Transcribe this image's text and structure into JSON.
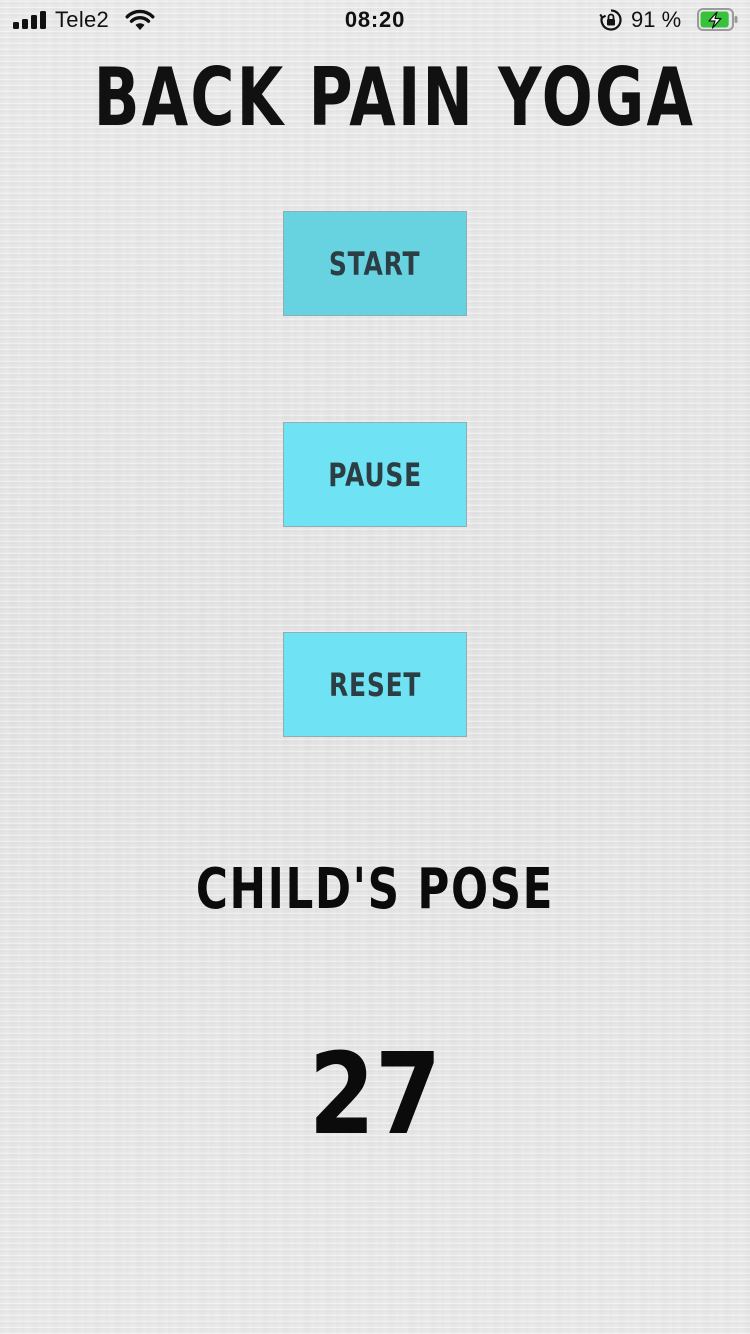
{
  "status_bar": {
    "carrier": "Tele2",
    "time": "08:20",
    "battery_percent": "91 %",
    "battery_level": 0.91,
    "icons": [
      "signal-icon",
      "wifi-icon",
      "orientation-lock-icon",
      "battery-charging-icon"
    ]
  },
  "app": {
    "title": "BACK PAIN YOGA"
  },
  "controls": {
    "start_label": "START",
    "pause_label": "PAUSE",
    "reset_label": "RESET"
  },
  "session": {
    "pose_name": "CHILD'S POSE",
    "seconds_remaining": "27"
  },
  "colors": {
    "button_bg": "#6fe3f3",
    "button_text": "#2c3e44",
    "background": "#e9e9e9",
    "battery_fill": "#38c23c"
  }
}
